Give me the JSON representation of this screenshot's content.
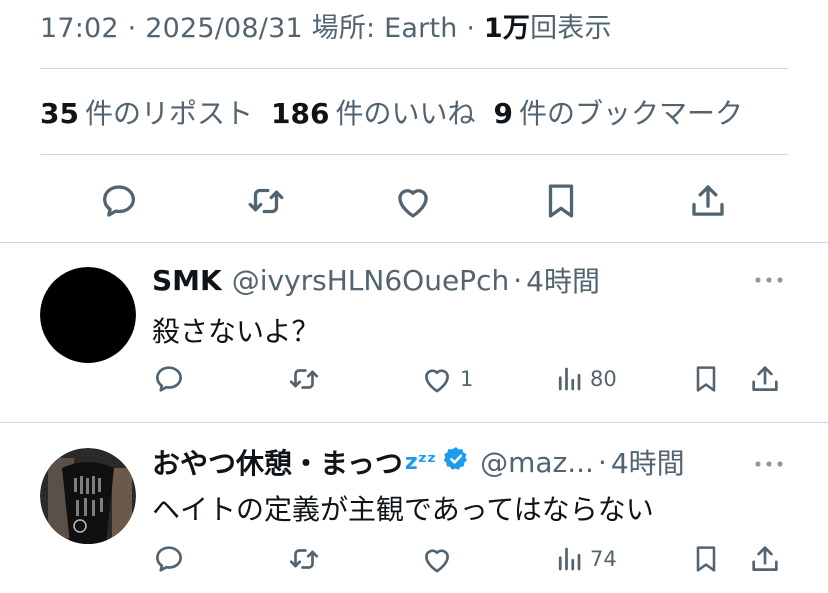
{
  "post": {
    "time": "17:02",
    "sep1": "·",
    "date": "2025/08/31",
    "location_label": "場所: Earth",
    "sep2": "·",
    "views_count": "1万",
    "views_label": "回表示"
  },
  "stats": {
    "reposts_count": "35",
    "reposts_label": "件のリポスト",
    "likes_count": "186",
    "likes_label": "件のいいね",
    "bookmarks_count": "9",
    "bookmarks_label": "件のブックマーク"
  },
  "replies": [
    {
      "name": "SMK",
      "handle": "@ivyrsHLN6OuePch",
      "sep": "·",
      "time": "4時間",
      "text": "殺さないよ？",
      "like_count": "1",
      "views_count": "80",
      "avatar_color": "#000000"
    },
    {
      "name": "おやつ休憩・まっつ",
      "name_emoji": "zᶻᶻ",
      "handle": "@maz...",
      "sep": "·",
      "time": "4時間",
      "text": "ヘイトの定義が主観であってはならない",
      "like_count": "",
      "views_count": "74",
      "avatar_color": "#2a2a2a"
    }
  ],
  "colors": {
    "accent": "#1d9bf0",
    "muted": "#536471",
    "text": "#0f1419",
    "divider": "#cfd9de"
  },
  "icons": [
    "reply-icon",
    "repost-icon",
    "like-icon",
    "bookmark-icon",
    "share-icon",
    "views-icon",
    "more-icon",
    "verified-badge-icon"
  ]
}
